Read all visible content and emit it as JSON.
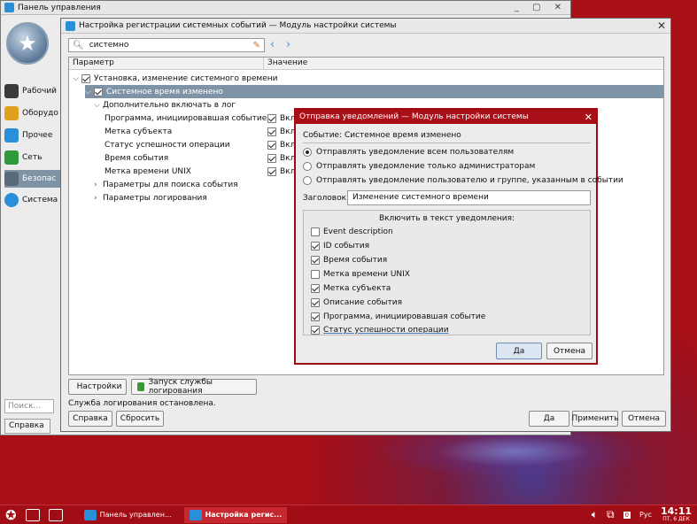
{
  "control_panel": {
    "title": "Панель управления",
    "window_controls": "_ ▢ ✕",
    "sidebar": [
      {
        "label": "Рабочий",
        "color": "#3a3a3a"
      },
      {
        "label": "Оборудо",
        "color": "#e0a020"
      },
      {
        "label": "Прочее",
        "color": "#2a8fd8"
      },
      {
        "label": "Сеть",
        "color": "#2e9a3a"
      },
      {
        "label": "Безопас",
        "color": "#5a6a7a"
      },
      {
        "label": "Система",
        "color": "#2a8fd8"
      }
    ],
    "search_placeholder": "Поиск...",
    "help_label": "Справка"
  },
  "main_dialog": {
    "title": "Настройка регистрации системных событий — Модуль настройки системы",
    "search_value": "системно",
    "columns": [
      "Параметр",
      "Значение"
    ],
    "tree": {
      "group_label": "Установка, изменение системного времени",
      "event_label": "Системное время изменено",
      "include_label": "Дополнительно включать в лог",
      "items": [
        {
          "label": "Программа, инициировавшая событие",
          "value": "Вкл"
        },
        {
          "label": "Метка субъекта",
          "value": "Вкл"
        },
        {
          "label": "Статус успешности операции",
          "value": "Вкл"
        },
        {
          "label": "Время события",
          "value": "Вкл"
        },
        {
          "label": "Метка времени UNIX",
          "value": "Вкл"
        }
      ],
      "search_params_label": "Параметры для поиска события",
      "log_params_label": "Параметры логирования"
    },
    "settings_button": "Настройки",
    "start_logging_button": "Запуск службы логирования",
    "status_text": "Служба логирования остановлена.",
    "help_button": "Справка",
    "reset_button": "Сбросить",
    "yes_button": "Да",
    "apply_button": "Применить",
    "cancel_button": "Отмена"
  },
  "notify_dialog": {
    "title": "Отправка уведомлений — Модуль настройки системы",
    "event_text": "Событие: Системное время изменено",
    "radios": [
      {
        "label": "Отправлять уведомление всем пользователям",
        "checked": true
      },
      {
        "label": "Отправлять уведомление только администраторам",
        "checked": false
      },
      {
        "label": "Отправлять уведомление пользователю и группе, указанным в событии",
        "checked": false
      }
    ],
    "header_label": "Заголовок:",
    "header_value": "Изменение системного времени",
    "include_title": "Включить в текст уведомления:",
    "include_items": [
      {
        "label": "Event description",
        "checked": false
      },
      {
        "label": "ID события",
        "checked": true
      },
      {
        "label": "Время события",
        "checked": true
      },
      {
        "label": "Метка времени UNIX",
        "checked": false
      },
      {
        "label": "Метка субъекта",
        "checked": true
      },
      {
        "label": "Описание события",
        "checked": true
      },
      {
        "label": "Программа, инициировавшая событие",
        "checked": true
      },
      {
        "label": "Статус успешности операции",
        "checked": true
      }
    ],
    "ok_button": "Да",
    "cancel_button": "Отмена"
  },
  "taskbar": {
    "tasks": [
      "Панель управлен...",
      "Настройка регис..."
    ],
    "layout": "Рус",
    "time": "14:11",
    "date": "ПТ, 6 ДЕК"
  }
}
